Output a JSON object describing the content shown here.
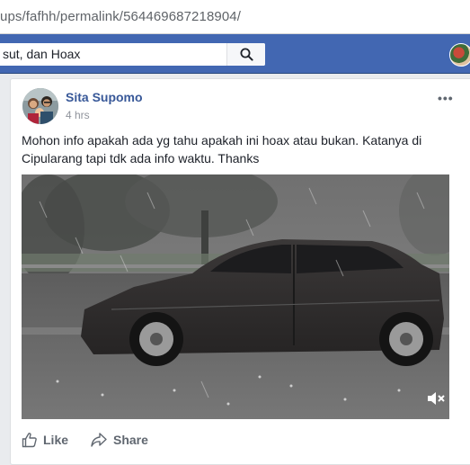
{
  "browser": {
    "url": "ups/fafhh/permalink/564469687218904/"
  },
  "header": {
    "search_value": "sut, dan Hoax",
    "search_icon": "search-icon"
  },
  "post": {
    "author": "Sita Supomo",
    "time": "4 hrs",
    "more": "•••",
    "text": "Mohon info apakah ada yg tahu apakah ini hoax atau bukan. Katanya di Cipularang tapi tdk ada info waktu. Thanks",
    "video": {
      "muted_icon": "volume-muted-icon"
    },
    "actions": {
      "like_label": "Like",
      "share_label": "Share"
    }
  },
  "colors": {
    "fb_blue": "#4267b2",
    "author_link": "#385898",
    "text": "#1d2129",
    "muted_text": "#90949c",
    "action_text": "#606770"
  }
}
